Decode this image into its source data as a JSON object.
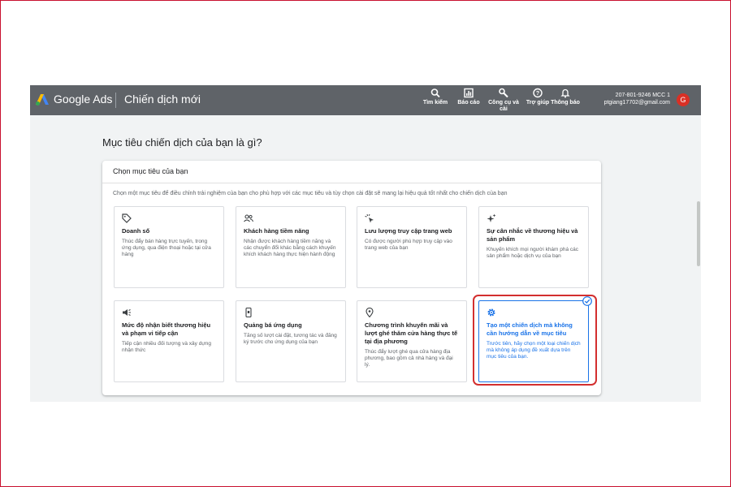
{
  "header": {
    "brand": "Google Ads",
    "title": "Chiến dịch mới",
    "tools": [
      {
        "label": "Tìm kiếm",
        "icon": "search-icon"
      },
      {
        "label": "Báo cáo",
        "icon": "reports-icon"
      },
      {
        "label": "Công cụ và cài",
        "icon": "tools-icon"
      },
      {
        "label": "Trợ giúp",
        "icon": "help-icon"
      },
      {
        "label": "Thông báo",
        "icon": "notifications-icon"
      }
    ],
    "account_id": "207-801-9246 MCC 1",
    "account_email": "ptgiang17702@gmail.com",
    "avatar_letter": "G"
  },
  "page": {
    "title": "Mục tiêu chiến dịch của bạn là gì?"
  },
  "card": {
    "header": "Chọn mục tiêu của bạn",
    "description": "Chọn một mục tiêu để điều chỉnh trải nghiệm của bạn cho phù hợp với các mục tiêu và tùy chọn cài đặt sẽ mang lại hiệu quả tốt nhất cho chiến dịch của bạn"
  },
  "goals": [
    {
      "title": "Doanh số",
      "desc": "Thúc đẩy bán hàng trực tuyến, trong ứng dụng, qua điện thoại hoặc tại cửa hàng",
      "icon": "tag-icon",
      "selected": false
    },
    {
      "title": "Khách hàng tiềm năng",
      "desc": "Nhận được khách hàng tiềm năng và các chuyển đổi khác bằng cách khuyến khích khách hàng thực hiện hành động",
      "icon": "people-icon",
      "selected": false
    },
    {
      "title": "Lưu lượng truy cập trang web",
      "desc": "Có được người phù hợp truy cập vào trang web của bạn",
      "icon": "click-icon",
      "selected": false
    },
    {
      "title": "Sự cân nhắc về thương hiệu và sản phẩm",
      "desc": "Khuyến khích mọi người khám phá các sản phẩm hoặc dịch vụ của bạn",
      "icon": "sparkle-icon",
      "selected": false
    },
    {
      "title": "Mức độ nhận biết thương hiệu và phạm vi tiếp cận",
      "desc": "Tiếp cận nhiều đối tượng và xây dựng nhận thức",
      "icon": "megaphone-icon",
      "selected": false
    },
    {
      "title": "Quảng bá ứng dụng",
      "desc": "Tăng số lượt cài đặt, tương tác và đăng ký trước cho ứng dụng của bạn",
      "icon": "phone-icon",
      "selected": false
    },
    {
      "title": "Chương trình khuyến mãi và lượt ghé thăm cửa hàng thực tế tại địa phương",
      "desc": "Thúc đẩy lượt ghé qua cửa hàng địa phương, bao gồm cả nhà hàng và đại lý.",
      "icon": "location-pin-icon",
      "selected": false
    },
    {
      "title": "Tạo một chiến dịch mà không cần hướng dẫn về mục tiêu",
      "desc": "Trước tiên, hãy chọn một loại chiến dịch mà không áp dụng đề xuất dựa trên mục tiêu của bạn.",
      "icon": "gear-icon",
      "selected": true
    }
  ],
  "colors": {
    "topbar": "#5f6368",
    "background": "#f1f3f4",
    "selected": "#1a73e8",
    "highlight": "#d32f2f",
    "avatar": "#d93025"
  }
}
